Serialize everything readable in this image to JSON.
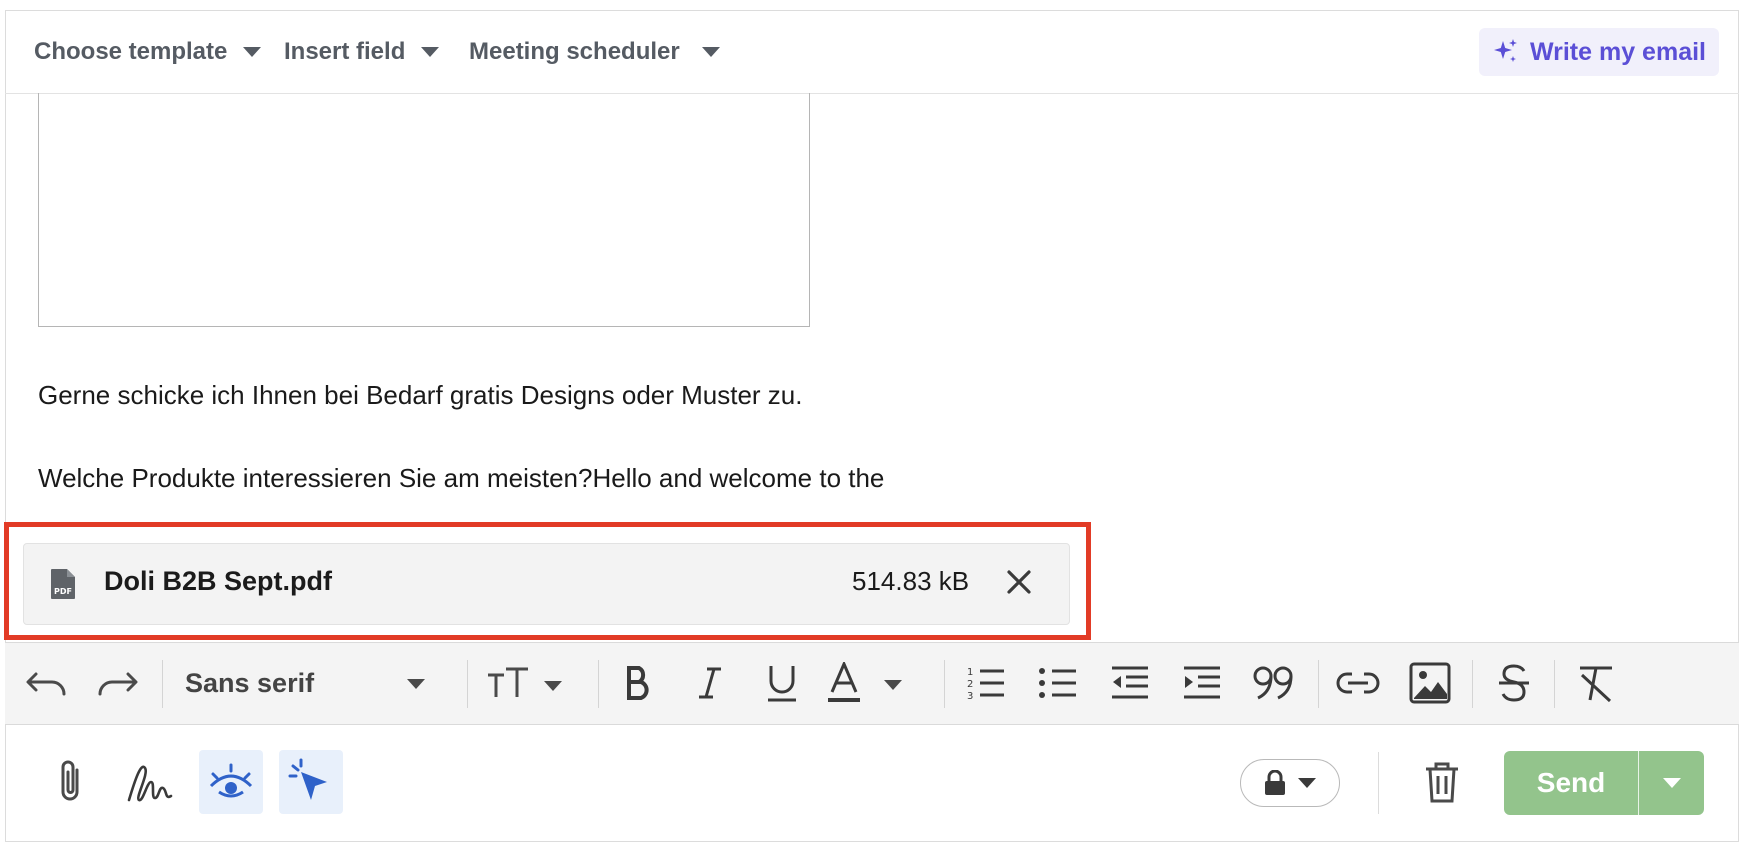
{
  "toolbar_top": {
    "choose_template": "Choose template",
    "insert_field": "Insert field",
    "meeting_scheduler": "Meeting scheduler",
    "write_my_email": "Write my email"
  },
  "message": {
    "line1": "Gerne schicke ich Ihnen bei Bedarf gratis Designs oder Muster zu.",
    "line2": "Welche Produkte interessieren Sie am meisten?Hello and welcome to the"
  },
  "attachment": {
    "name": "Doli B2B Sept.pdf",
    "size": "514.83 kB",
    "icon": "pdf-file-icon"
  },
  "format_toolbar": {
    "font_family": "Sans serif",
    "icons": [
      "undo-icon",
      "redo-icon",
      "font-size-icon",
      "bold-icon",
      "italic-icon",
      "underline-icon",
      "text-color-icon",
      "numbered-list-icon",
      "bulleted-list-icon",
      "outdent-icon",
      "indent-icon",
      "quote-icon",
      "link-icon",
      "image-icon",
      "strikethrough-icon",
      "clear-format-icon"
    ]
  },
  "actions": {
    "send_label": "Send",
    "send_color": "#93c48c",
    "accent_color": "#5b4fd6",
    "highlight_color": "#e23b26"
  }
}
